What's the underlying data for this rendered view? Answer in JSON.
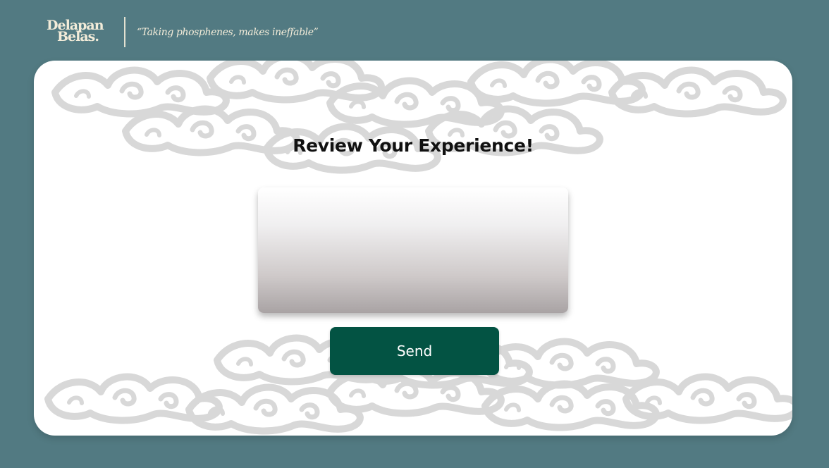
{
  "header": {
    "logo_line1": "Delapan",
    "logo_line2": "Belas.",
    "tagline": "“Taking phosphenes, makes ineffable”"
  },
  "review": {
    "title": "Review Your Experience!",
    "textarea_placeholder": "",
    "send_label": "Send"
  },
  "colors": {
    "background": "#527a82",
    "card": "#ffffff",
    "send_button": "#035343",
    "logo_text": "#f3ecd9"
  }
}
